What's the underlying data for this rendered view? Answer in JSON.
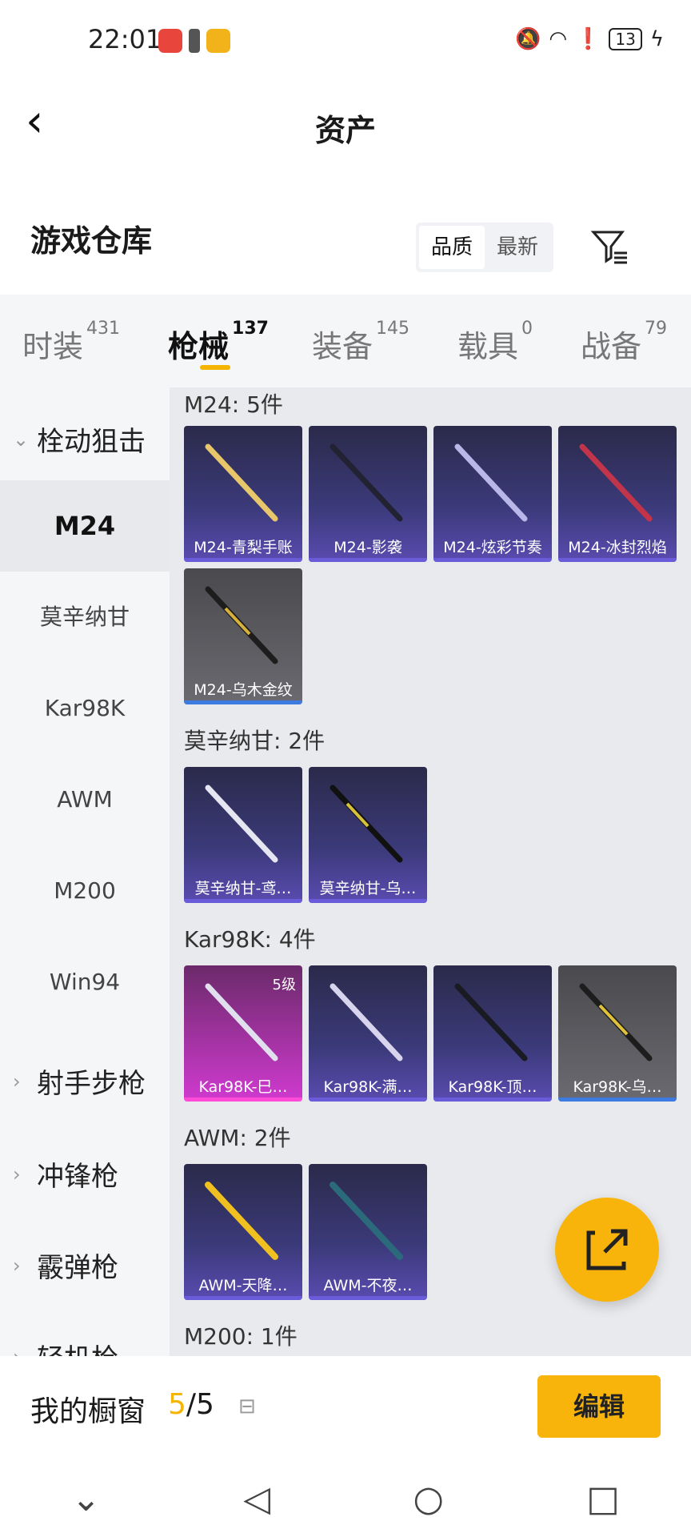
{
  "status": {
    "time": "22:01",
    "battery": "13"
  },
  "header": {
    "title": "资产"
  },
  "warehouse": {
    "title": "游戏仓库",
    "sort": [
      "品质",
      "最新"
    ]
  },
  "tabs": [
    {
      "label": "时装",
      "count": "431"
    },
    {
      "label": "枪械",
      "count": "137"
    },
    {
      "label": "装备",
      "count": "145"
    },
    {
      "label": "载具",
      "count": "0"
    },
    {
      "label": "战备",
      "count": "79"
    }
  ],
  "sidebar": {
    "cat1": "栓动狙击",
    "subs": [
      "M24",
      "莫辛纳甘",
      "Kar98K",
      "AWM",
      "M200",
      "Win94"
    ],
    "cats": [
      "射手步枪",
      "冲锋枪",
      "霰弹枪",
      "轻机枪"
    ]
  },
  "sections": {
    "m24": {
      "title": "M24: 5件",
      "items": [
        "M24-青梨手账",
        "M24-影袭",
        "M24-炫彩节奏",
        "M24-冰封烈焰",
        "M24-乌木金纹"
      ]
    },
    "mosin": {
      "title": "莫辛纳甘: 2件",
      "items": [
        "莫辛纳甘-鸢…",
        "莫辛纳甘-乌…"
      ]
    },
    "kar": {
      "title": "Kar98K: 4件",
      "items": [
        "Kar98K-巳…",
        "Kar98K-满…",
        "Kar98K-顶…",
        "Kar98K-乌…"
      ],
      "level": "5级"
    },
    "awm": {
      "title": "AWM: 2件",
      "items": [
        "AWM-天降…",
        "AWM-不夜…"
      ]
    },
    "m200": {
      "title": "M200: 1件"
    }
  },
  "showcase": {
    "label": "我的橱窗",
    "current": "5",
    "total": "/5",
    "edit": "编辑"
  }
}
